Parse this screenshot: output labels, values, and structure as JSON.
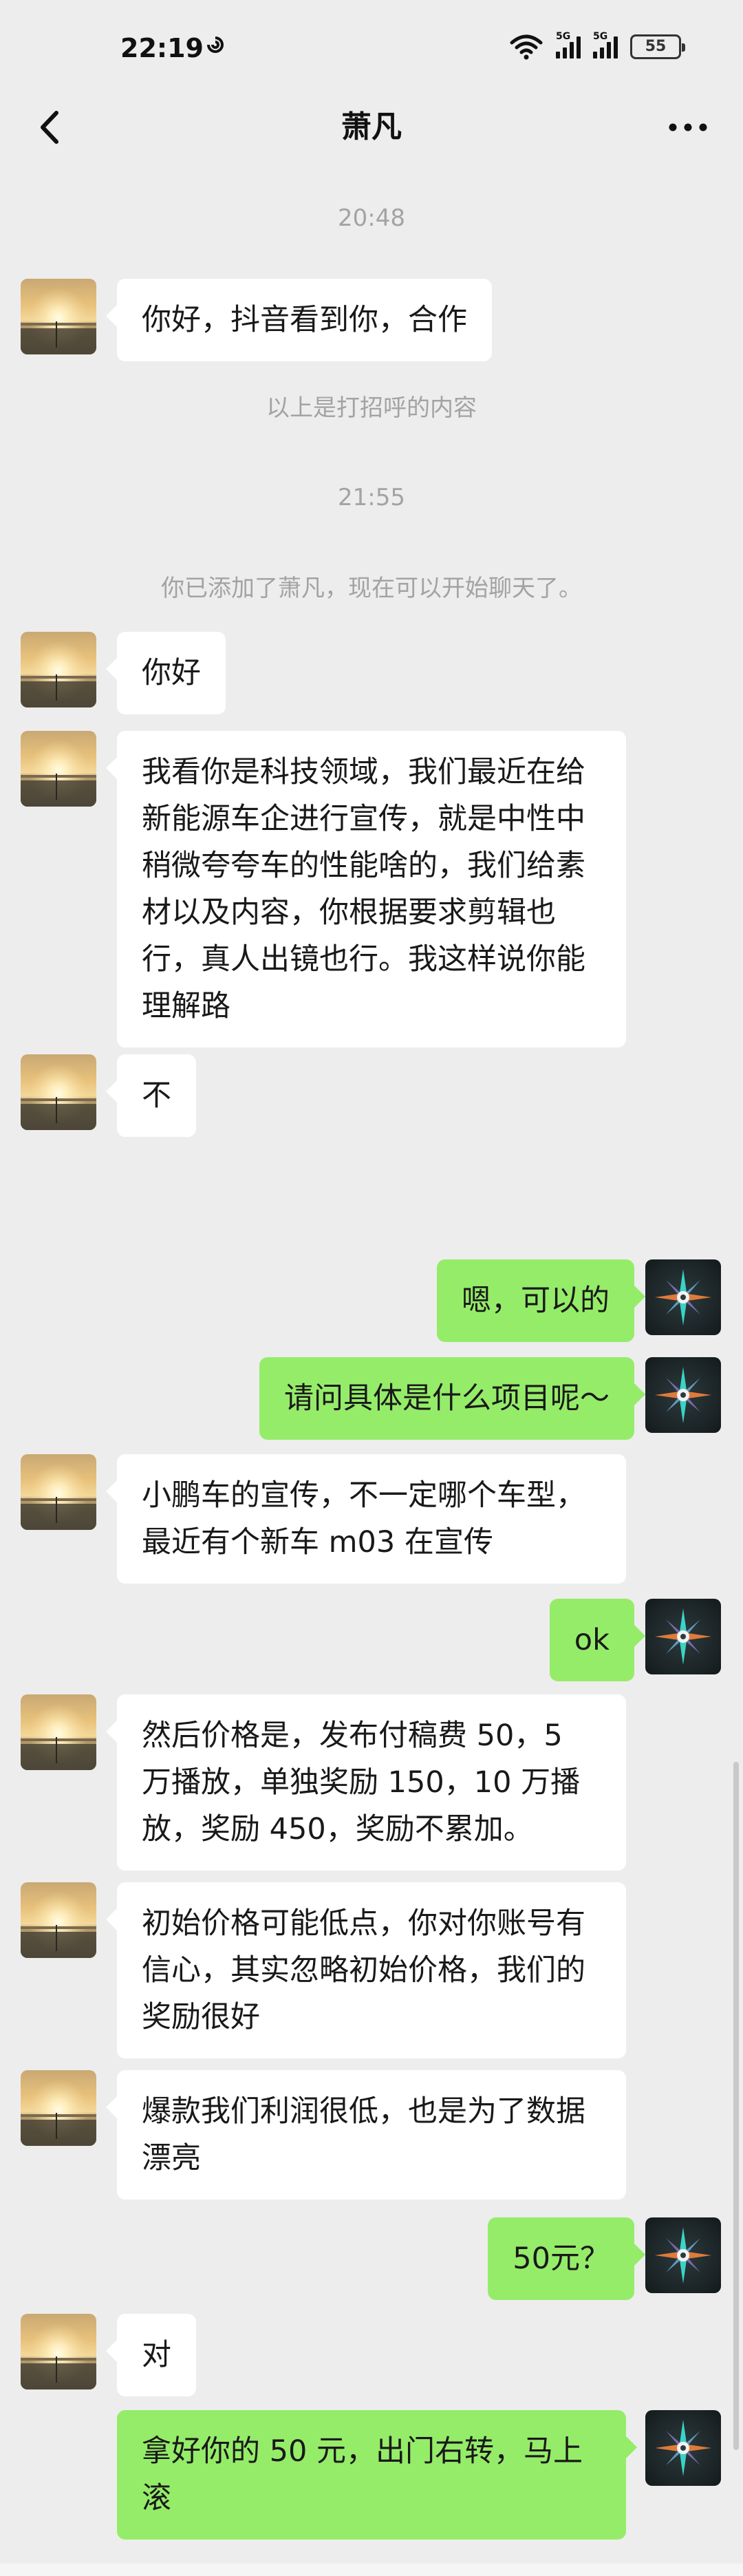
{
  "status_bar": {
    "time": "22:19",
    "battery": "55",
    "signal_1": "5G",
    "signal_2": "5G"
  },
  "nav": {
    "title": "萧凡"
  },
  "system": {
    "time_1": "20:48",
    "greeting_note": "以上是打招呼的内容",
    "time_2": "21:55",
    "added_note": "你已添加了萧凡，现在可以开始聊天了。"
  },
  "messages": [
    {
      "side": "left",
      "text": "你好，抖音看到你，合作"
    },
    {
      "side": "left",
      "text": "你好"
    },
    {
      "side": "left",
      "text": "我看你是科技领域，我们最近在给新能源车企进行宣传，就是中性中稍微夸夸车的性能啥的，我们给素材以及内容，你根据要求剪辑也行，真人出镜也行。我这样说你能理解路"
    },
    {
      "side": "left",
      "text": "不"
    },
    {
      "side": "right",
      "text": "嗯，可以的"
    },
    {
      "side": "right",
      "text": "请问具体是什么项目呢～"
    },
    {
      "side": "left",
      "text": "小鹏车的宣传，不一定哪个车型，最近有个新车 m03 在宣传"
    },
    {
      "side": "right",
      "text": "ok"
    },
    {
      "side": "left",
      "text": "然后价格是，发布付稿费 50，5 万播放，单独奖励 150，10 万播放，奖励 450，奖励不累加。"
    },
    {
      "side": "left",
      "text": "初始价格可能低点，你对你账号有信心，其实忽略初始价格，我们的奖励很好"
    },
    {
      "side": "left",
      "text": "爆款我们利润很低，也是为了数据漂亮"
    },
    {
      "side": "right",
      "text": "50元？"
    },
    {
      "side": "left",
      "text": "对"
    },
    {
      "side": "right",
      "text": "拿好你的 50 元，出门右转，马上滚"
    }
  ],
  "colors": {
    "background": "#ededed",
    "bubble_self": "#95ec69",
    "bubble_other": "#ffffff",
    "system_text": "#a3a3a3"
  },
  "icons": {
    "back": "back-chevron-icon",
    "more": "more-dots-icon",
    "wifi": "wifi-icon",
    "location": "location-icon"
  }
}
